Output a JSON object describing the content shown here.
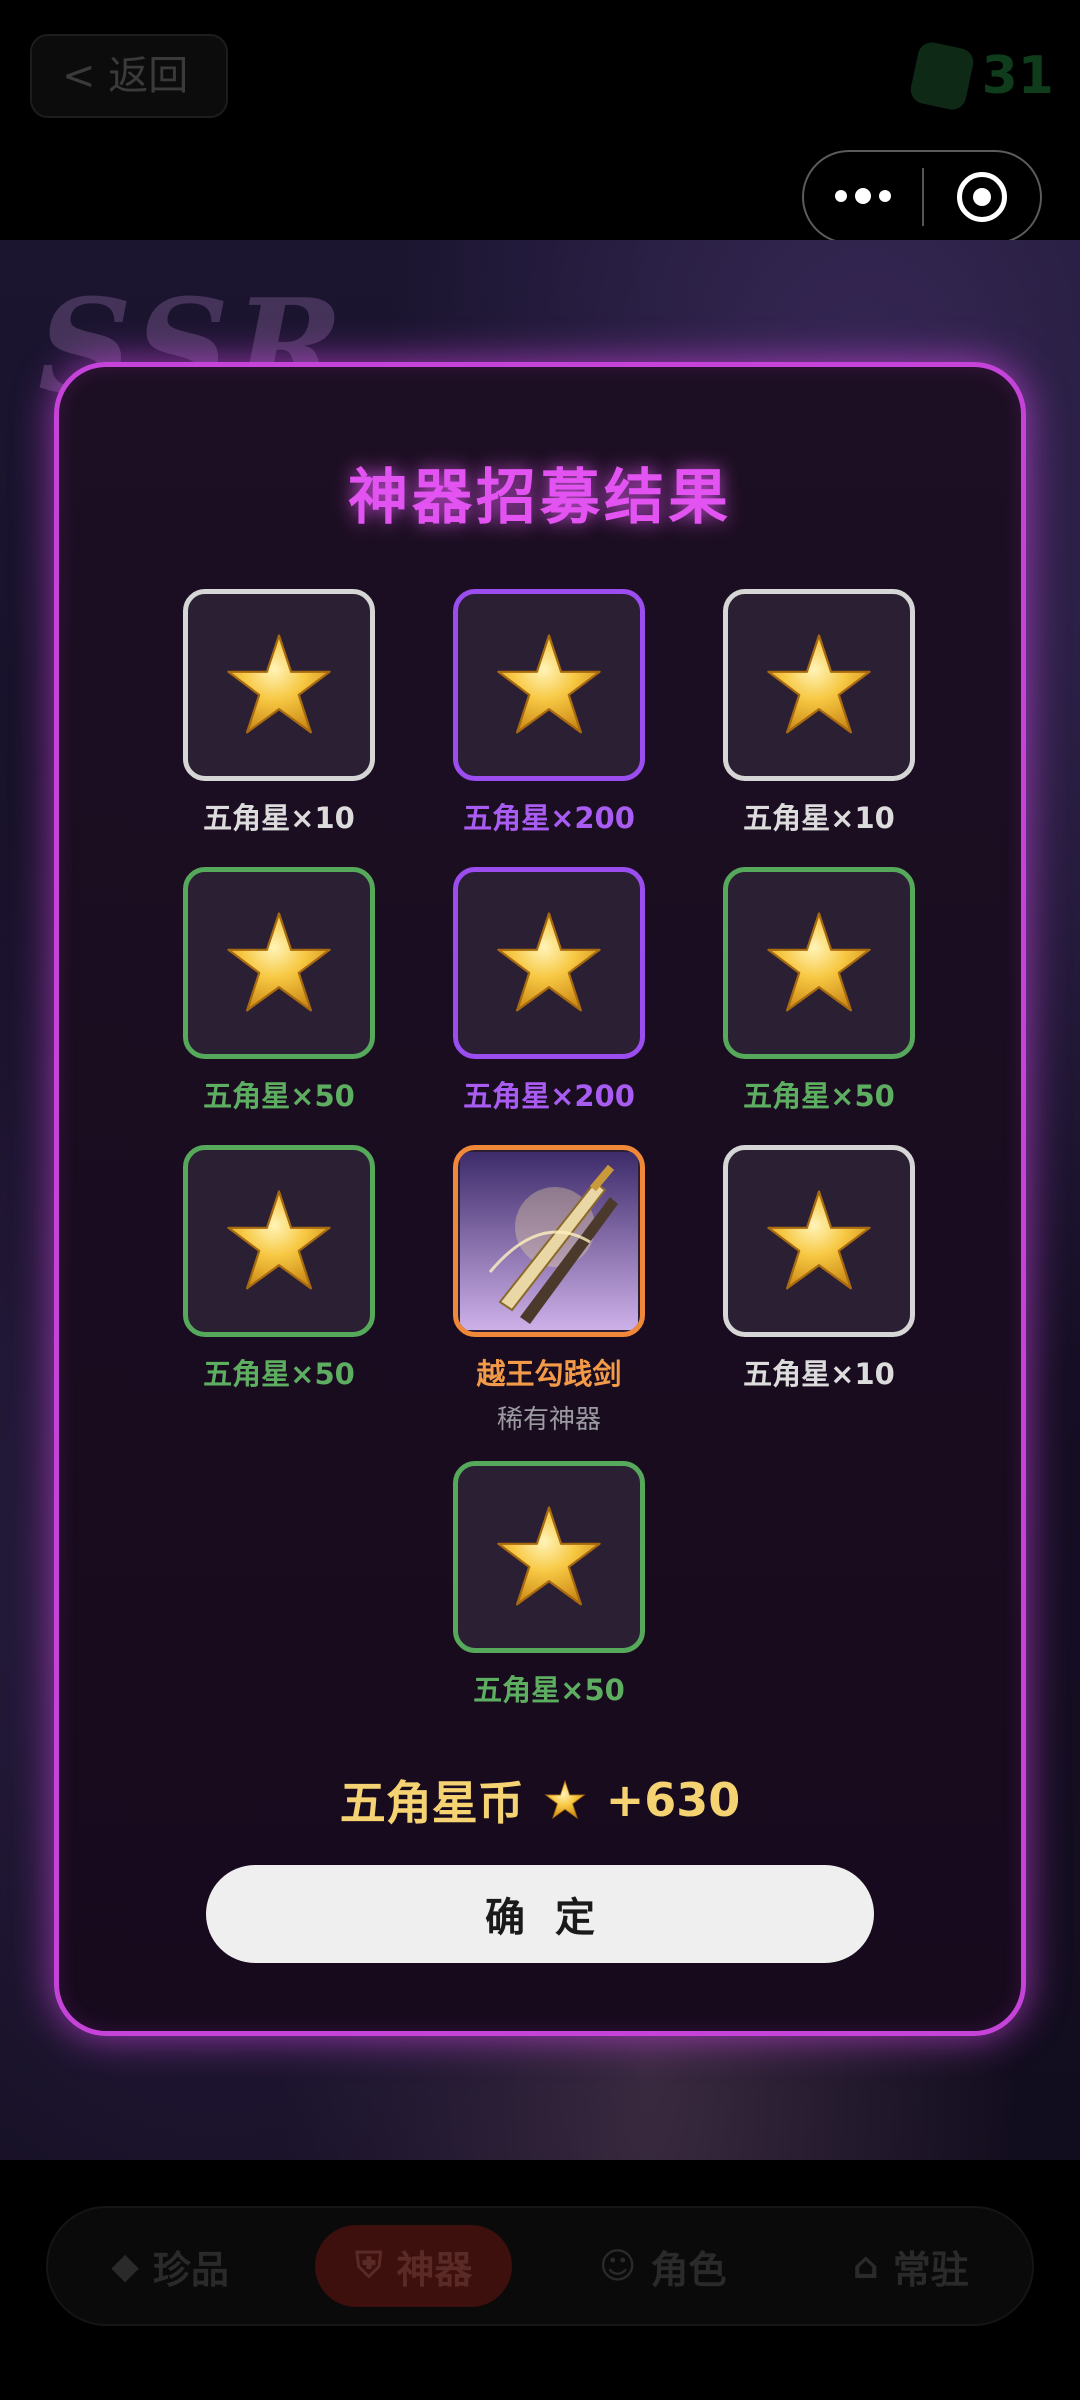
{
  "topbar": {
    "back_label": "< 返回",
    "gem_count": "31"
  },
  "background_text": "SSR",
  "dialog": {
    "title": "神器招募结果",
    "items": [
      {
        "label": "五角星×10",
        "tier": "white",
        "icon": "star-icon"
      },
      {
        "label": "五角星×200",
        "tier": "purple",
        "icon": "star-icon"
      },
      {
        "label": "五角星×10",
        "tier": "white",
        "icon": "star-icon"
      },
      {
        "label": "五角星×50",
        "tier": "green",
        "icon": "star-icon"
      },
      {
        "label": "五角星×200",
        "tier": "purple",
        "icon": "star-icon"
      },
      {
        "label": "五角星×50",
        "tier": "green",
        "icon": "star-icon"
      },
      {
        "label": "五角星×50",
        "tier": "green",
        "icon": "star-icon"
      },
      {
        "label": "越王勾践剑",
        "sublabel": "稀有神器",
        "tier": "orange",
        "icon": "sword-icon"
      },
      {
        "label": "五角星×10",
        "tier": "white",
        "icon": "star-icon"
      },
      {
        "label": "五角星×50",
        "tier": "green",
        "icon": "star-icon"
      }
    ],
    "total_label": "五角星币",
    "total_value": "+630",
    "confirm_label": "确定"
  },
  "tabs": [
    {
      "label": "珍品",
      "icon": "diamond-icon",
      "active": false
    },
    {
      "label": "神器",
      "icon": "shield-icon",
      "active": true
    },
    {
      "label": "角色",
      "icon": "mask-icon",
      "active": false
    },
    {
      "label": "常驻",
      "icon": "bank-icon",
      "active": false
    }
  ],
  "colors": {
    "dialog_border": "#c643d9",
    "title": "#e253f2",
    "tier_white": "#d6d6d6",
    "tier_purple": "#9b4df0",
    "tier_green": "#56a85a",
    "tier_orange": "#f0883a",
    "total": "#f6d372"
  }
}
